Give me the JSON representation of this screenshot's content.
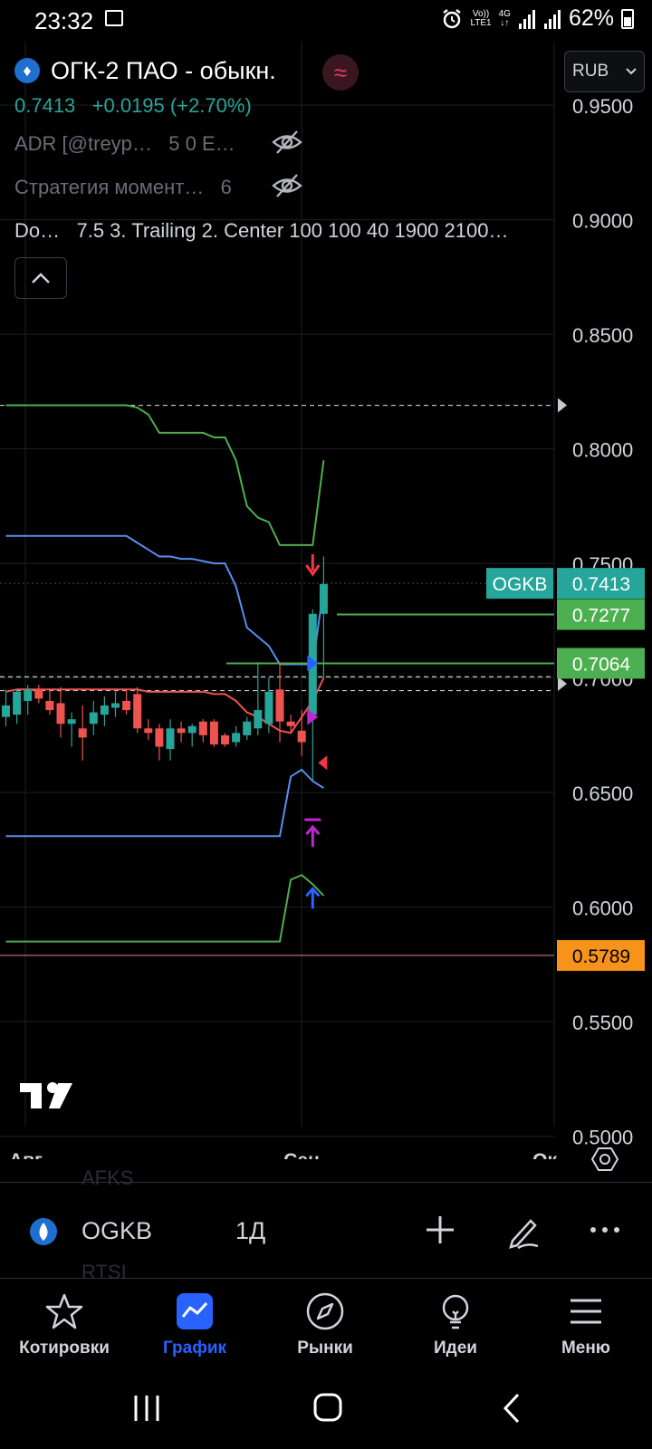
{
  "status_bar": {
    "time": "23:32",
    "network_top": "Vo))",
    "network_bottom": "LTE1",
    "network_type": "4G",
    "battery": "62%"
  },
  "header": {
    "symbol_title": "ОГК-2 ПАО - обыкн.",
    "price": "0.7413",
    "change": "+0.0195 (+2.70%)",
    "indicators": [
      {
        "name": "ADR [@treyp…",
        "params": "5 0 E…"
      },
      {
        "name": "Стратегия момент…",
        "params": "6"
      },
      {
        "name": "Do…",
        "params": "7.5 3. Trailing 2. Center 100 100 40 1900 2100…"
      }
    ],
    "currency": "RUB"
  },
  "chart_data": {
    "type": "candlestick",
    "ylim": [
      0.49,
      0.9777
    ],
    "y_ticks": [
      "0.9500",
      "0.9000",
      "0.8500",
      "0.8000",
      "0.7500",
      "0.7000",
      "0.6500",
      "0.6000",
      "0.5500",
      "0.5000"
    ],
    "x_labels": [
      "Авг",
      "Сен",
      "Ок"
    ],
    "price_labels": [
      {
        "symbol": "OGKB",
        "value": "0.7413",
        "color": "#26a69a"
      },
      {
        "value": "0.7277",
        "color": "#4caf50"
      },
      {
        "value": "0.7064",
        "color": "#4caf50"
      },
      {
        "value": "0.5789",
        "color": "#f7931a"
      }
    ],
    "candles": [
      {
        "o": 0.683,
        "h": 0.695,
        "l": 0.679,
        "c": 0.688
      },
      {
        "o": 0.684,
        "h": 0.695,
        "l": 0.68,
        "c": 0.694
      },
      {
        "o": 0.69,
        "h": 0.697,
        "l": 0.684,
        "c": 0.695
      },
      {
        "o": 0.695,
        "h": 0.697,
        "l": 0.689,
        "c": 0.691
      },
      {
        "o": 0.69,
        "h": 0.695,
        "l": 0.684,
        "c": 0.686
      },
      {
        "o": 0.689,
        "h": 0.696,
        "l": 0.674,
        "c": 0.68
      },
      {
        "o": 0.68,
        "h": 0.685,
        "l": 0.67,
        "c": 0.682
      },
      {
        "o": 0.678,
        "h": 0.688,
        "l": 0.664,
        "c": 0.674
      },
      {
        "o": 0.68,
        "h": 0.69,
        "l": 0.675,
        "c": 0.685
      },
      {
        "o": 0.684,
        "h": 0.692,
        "l": 0.679,
        "c": 0.688
      },
      {
        "o": 0.687,
        "h": 0.694,
        "l": 0.683,
        "c": 0.689
      },
      {
        "o": 0.69,
        "h": 0.695,
        "l": 0.684,
        "c": 0.686
      },
      {
        "o": 0.693,
        "h": 0.696,
        "l": 0.676,
        "c": 0.678
      },
      {
        "o": 0.678,
        "h": 0.682,
        "l": 0.673,
        "c": 0.676
      },
      {
        "o": 0.678,
        "h": 0.68,
        "l": 0.664,
        "c": 0.67
      },
      {
        "o": 0.669,
        "h": 0.682,
        "l": 0.664,
        "c": 0.678
      },
      {
        "o": 0.678,
        "h": 0.681,
        "l": 0.672,
        "c": 0.676
      },
      {
        "o": 0.676,
        "h": 0.68,
        "l": 0.67,
        "c": 0.679
      },
      {
        "o": 0.681,
        "h": 0.682,
        "l": 0.672,
        "c": 0.675
      },
      {
        "o": 0.681,
        "h": 0.682,
        "l": 0.67,
        "c": 0.671
      },
      {
        "o": 0.675,
        "h": 0.676,
        "l": 0.67,
        "c": 0.671
      },
      {
        "o": 0.672,
        "h": 0.679,
        "l": 0.67,
        "c": 0.676
      },
      {
        "o": 0.675,
        "h": 0.683,
        "l": 0.673,
        "c": 0.681
      },
      {
        "o": 0.678,
        "h": 0.707,
        "l": 0.675,
        "c": 0.686
      },
      {
        "o": 0.68,
        "h": 0.7,
        "l": 0.676,
        "c": 0.694
      },
      {
        "o": 0.695,
        "h": 0.707,
        "l": 0.672,
        "c": 0.681
      },
      {
        "o": 0.681,
        "h": 0.684,
        "l": 0.676,
        "c": 0.679
      },
      {
        "o": 0.677,
        "h": 0.686,
        "l": 0.666,
        "c": 0.672
      },
      {
        "o": 0.684,
        "h": 0.73,
        "l": 0.655,
        "c": 0.728
      },
      {
        "o": 0.728,
        "h": 0.753,
        "l": 0.7,
        "c": 0.741
      }
    ],
    "colors": {
      "up": "#26a69a",
      "down": "#ef5350",
      "upper_outer": "#4caf50",
      "upper_inner": "#5b8def",
      "lower_inner": "#5b8def",
      "lower_outer": "#4caf50",
      "mid": "#ef5350"
    }
  },
  "toolbar": {
    "symbol": "OGKB",
    "interval": "1Д",
    "ghost_above": "AFKS",
    "ghost_below": "RTSI"
  },
  "nav": {
    "items": [
      {
        "label": "Котировки",
        "icon": "star-icon"
      },
      {
        "label": "График",
        "icon": "chart-icon"
      },
      {
        "label": "Рынки",
        "icon": "compass-icon"
      },
      {
        "label": "Идеи",
        "icon": "lightbulb-icon"
      },
      {
        "label": "Меню",
        "icon": "menu-icon"
      }
    ]
  }
}
